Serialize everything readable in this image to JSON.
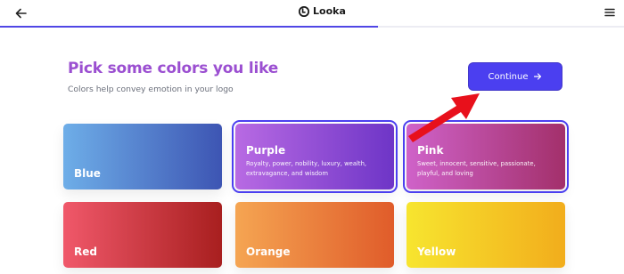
{
  "header": {
    "brand": "Looka",
    "progress_fraction": 0.605
  },
  "main": {
    "title": "Pick some colors you like",
    "subtitle": "Colors help convey emotion in your logo",
    "continue_label": "Continue"
  },
  "colors": [
    {
      "name": "Blue",
      "description": "",
      "selected": false
    },
    {
      "name": "Purple",
      "description": "Royalty, power, nobility, luxury, wealth, extravagance, and wisdom",
      "selected": true
    },
    {
      "name": "Pink",
      "description": "Sweet, innocent, sensitive, passionate, playful, and loving",
      "selected": true
    },
    {
      "name": "Red",
      "description": "",
      "selected": false
    },
    {
      "name": "Orange",
      "description": "",
      "selected": false
    },
    {
      "name": "Yellow",
      "description": "",
      "selected": false
    }
  ],
  "icons": {
    "back": "arrow-left-icon",
    "menu": "hamburger-menu-icon",
    "logo": "looka-logo-icon",
    "continue": "arrow-right-icon",
    "annotation": "red-pointer-arrow"
  },
  "theme": {
    "accent": "#4b3ff0",
    "title_color": "#9b4fd1",
    "annotation_color": "#e8101b"
  }
}
